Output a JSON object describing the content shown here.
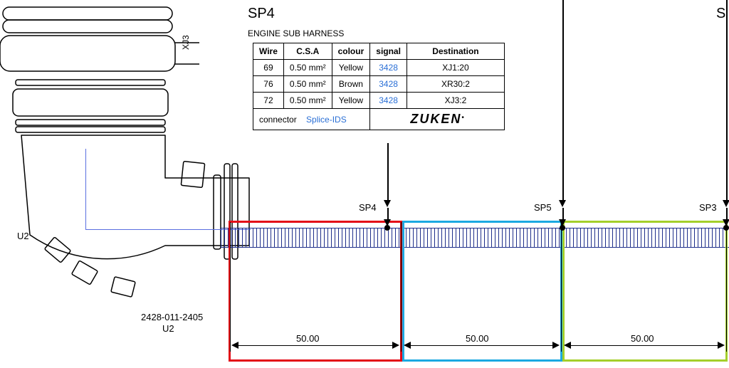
{
  "splice_block": {
    "title": "SP4",
    "title_clipped": "S",
    "subtitle": "ENGINE SUB HARNESS",
    "header": {
      "wire": "Wire",
      "csa": "C.S.A",
      "colour": "colour",
      "signal": "signal",
      "dest": "Destination"
    },
    "rows": [
      {
        "wire": "69",
        "csa": "0.50 mm²",
        "colour": "Yellow",
        "signal": "3428",
        "dest": "XJ1:20"
      },
      {
        "wire": "76",
        "csa": "0.50 mm²",
        "colour": "Brown",
        "signal": "3428",
        "dest": "XR30:2"
      },
      {
        "wire": "72",
        "csa": "0.50 mm²",
        "colour": "Yellow",
        "signal": "3428",
        "dest": "XJ3:2"
      }
    ],
    "footer_left": "connector",
    "footer_link": "Splice-IDS",
    "footer_logo": "ZUKEN"
  },
  "connector": {
    "side_label": "XJ3",
    "refdes_left": "U2",
    "part_number": "2428-011-2405",
    "refdes_bottom": "U2"
  },
  "splices": {
    "sp4": "SP4",
    "sp5": "SP5",
    "sp3": "SP3"
  },
  "segments": [
    {
      "id": "seg-red",
      "length": "50.00",
      "color": "#e30a17"
    },
    {
      "id": "seg-blue",
      "length": "50.00",
      "color": "#1ba9e1"
    },
    {
      "id": "seg-green",
      "length": "50.00",
      "color": "#a4cf2a"
    }
  ]
}
